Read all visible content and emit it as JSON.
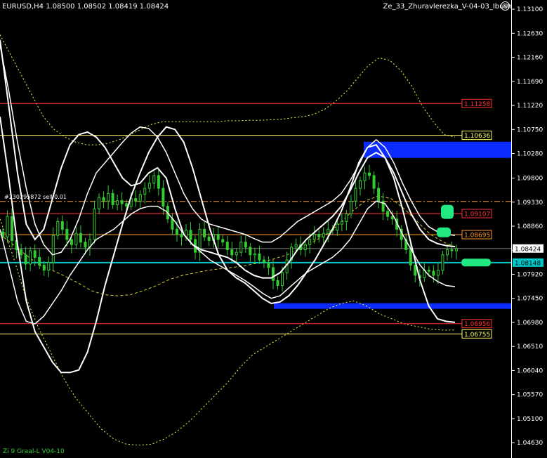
{
  "header": {
    "symbol_info": "EURUSD,H4  1.08500 1.08502 1.08419 1.08424",
    "indicator_name": "Ze_33_Zhuravlerezka_V-04-03_Ibush"
  },
  "footer": {
    "label": "Zi 9 Graal-L V04-10"
  },
  "order_label": "#230295872 sell 0.01",
  "colors": {
    "background": "#000000",
    "candles": "#33cc33",
    "bands": "#ffffff",
    "zone": "#0b2bff",
    "marker": "#22e882",
    "bid_line": "#00c8c8"
  },
  "chart_data": {
    "type": "candlestick",
    "symbol": "EURUSD",
    "timeframe": "H4",
    "ohlc": {
      "open": 1.085,
      "high": 1.08502,
      "low": 1.08419,
      "close": 1.08424
    },
    "ylim": [
      1.0433,
      1.1328
    ],
    "y_ticks": [
      "1.13100",
      "1.12630",
      "1.12160",
      "1.11690",
      "1.11220",
      "1.10750",
      "1.10280",
      "1.09800",
      "1.09330",
      "1.08860",
      "1.08390",
      "1.07920",
      "1.07450",
      "1.06980",
      "1.06510",
      "1.06040",
      "1.05570",
      "1.05100",
      "1.04630"
    ],
    "price_lines": [
      {
        "label": "1.11258",
        "value": 1.11258,
        "color": "#ff3333",
        "style": "solid"
      },
      {
        "label": "1.10636",
        "value": 1.10636,
        "color": "#ffff66",
        "style": "solid"
      },
      {
        "label": "1.09107",
        "value": 1.09107,
        "color": "#ff3333",
        "style": "solid"
      },
      {
        "label": "1.08695",
        "value": 1.08695,
        "color": "#ff9933",
        "style": "solid"
      },
      {
        "label": "1.06956",
        "value": 1.06956,
        "color": "#ff3333",
        "style": "solid"
      },
      {
        "label": "1.06755",
        "value": 1.06755,
        "color": "#ffff66",
        "style": "solid"
      }
    ],
    "order_line": {
      "value": 1.09344,
      "color": "#ff9933"
    },
    "current_price": {
      "label": "1.08424",
      "value": 1.08424
    },
    "bid_line": {
      "label": "1.08148",
      "value": 1.08148
    },
    "zones": [
      {
        "from": 1.10195,
        "to": 1.1051
      },
      {
        "from": 1.07245,
        "to": 1.07355
      }
    ],
    "markers": [
      {
        "index": 95,
        "value": 1.0914
      },
      {
        "index": 96,
        "value": 1.0874
      },
      {
        "index": 102,
        "value": 1.0815
      }
    ],
    "closes": [
      1.0865,
      1.0905,
      1.0858,
      1.084,
      1.083,
      1.0812,
      1.0838,
      1.0825,
      1.081,
      1.08,
      1.0815,
      1.0868,
      1.0895,
      1.088,
      1.086,
      1.085,
      1.0872,
      1.0855,
      1.0845,
      1.086,
      1.092,
      1.0942,
      1.0935,
      1.095,
      1.0928,
      1.0936,
      1.093,
      1.0925,
      1.094,
      1.0935,
      1.0948,
      1.096,
      1.097,
      1.0985,
      1.096,
      1.0925,
      1.09,
      1.088,
      1.087,
      1.0865,
      1.0878,
      1.086,
      1.0835,
      1.088,
      1.0865,
      1.0858,
      1.087,
      1.086,
      1.0855,
      1.084,
      1.083,
      1.0835,
      1.0855,
      1.0845,
      1.083,
      1.0832,
      1.082,
      1.0815,
      1.0805,
      1.078,
      1.077,
      1.0795,
      1.082,
      1.0845,
      1.085,
      1.084,
      1.085,
      1.086,
      1.087,
      1.0865,
      1.0872,
      1.088,
      1.0878,
      1.089,
      1.0895,
      1.091,
      1.0935,
      1.096,
      1.0975,
      1.099,
      1.0985,
      1.096,
      1.0935,
      1.0915,
      1.0905,
      1.09,
      1.088,
      1.086,
      1.084,
      1.081,
      1.079,
      1.0785,
      1.08,
      1.0798,
      1.079,
      1.08,
      1.083,
      1.084,
      1.0838,
      1.0842
    ],
    "bands": {
      "mid": [
        1.102,
        1.096,
        1.09,
        1.085,
        1.081,
        1.079,
        1.078,
        1.0785,
        1.08,
        1.083,
        1.087,
        1.09,
        1.0925,
        1.095,
        1.0975,
        1.0995,
        1.101,
        1.1015,
        1.101,
        1.099,
        1.096,
        1.0925,
        1.0895,
        1.087,
        1.0855,
        1.0845,
        1.0838,
        1.083,
        1.0818,
        1.0808,
        1.08,
        1.0802,
        1.0815,
        1.083,
        1.0843,
        1.0855,
        1.0865,
        1.0878,
        1.089,
        1.0905,
        1.092,
        1.0945,
        1.0975,
        1.0995,
        1.099,
        1.0965,
        1.0935,
        1.0905,
        1.0878,
        1.0858,
        1.0845,
        1.0838,
        1.0832
      ],
      "upper": [
        1.124,
        1.115,
        1.105,
        1.096,
        1.089,
        1.085,
        1.083,
        1.0835,
        1.086,
        1.09,
        1.095,
        1.099,
        1.101,
        1.103,
        1.105,
        1.1068,
        1.108,
        1.1077,
        1.106,
        1.103,
        1.099,
        1.095,
        1.092,
        1.09,
        1.089,
        1.0885,
        1.088,
        1.0875,
        1.087,
        1.0862,
        1.0855,
        1.0855,
        1.0865,
        1.088,
        1.0895,
        1.0905,
        1.0915,
        1.0925,
        1.0935,
        1.095,
        1.0975,
        1.1005,
        1.104,
        1.1055,
        1.104,
        1.101,
        1.097,
        1.0935,
        1.0905,
        1.0885,
        1.0875,
        1.087,
        1.0868
      ],
      "lower": [
        1.088,
        1.081,
        1.074,
        1.07,
        1.0695,
        1.071,
        1.0735,
        1.076,
        1.079,
        1.0815,
        1.084,
        1.086,
        1.087,
        1.088,
        1.0895,
        1.091,
        1.092,
        1.0925,
        1.0925,
        1.0915,
        1.0895,
        1.087,
        1.085,
        1.0835,
        1.082,
        1.081,
        1.08,
        1.079,
        1.078,
        1.0768,
        1.0755,
        1.0745,
        1.075,
        1.0765,
        1.078,
        1.0795,
        1.0805,
        1.0815,
        1.0825,
        1.084,
        1.086,
        1.089,
        1.092,
        1.0935,
        1.093,
        1.0905,
        1.087,
        1.084,
        1.081,
        1.079,
        1.0778,
        1.077,
        1.0768
      ],
      "outer_upper": [
        1.125,
        1.112,
        1.099,
        1.089,
        1.086,
        1.088,
        1.094,
        1.1,
        1.1045,
        1.1065,
        1.107,
        1.106,
        1.104,
        1.101,
        1.098,
        1.0965,
        1.097,
        1.099,
        1.1,
        1.098,
        1.092,
        1.087,
        1.085,
        1.084,
        1.0835,
        1.083,
        1.0825,
        1.0815,
        1.08,
        1.079,
        1.0785,
        1.0785,
        1.0795,
        1.0815,
        1.084,
        1.086,
        1.0875,
        1.089,
        1.0905,
        1.0925,
        1.0955,
        1.099,
        1.102,
        1.103,
        1.102,
        1.099,
        1.095,
        1.091,
        1.088,
        1.086,
        1.0852,
        1.0848,
        1.0846
      ],
      "outer_lower": [
        1.11,
        1.098,
        1.085,
        1.074,
        1.068,
        1.065,
        1.062,
        1.06,
        1.06,
        1.0605,
        1.064,
        1.07,
        1.077,
        1.083,
        1.089,
        1.0945,
        1.099,
        1.103,
        1.106,
        1.108,
        1.1075,
        1.105,
        1.1,
        1.094,
        1.088,
        1.083,
        1.08,
        1.0785,
        1.0775,
        1.076,
        1.0745,
        1.0735,
        1.0738,
        1.075,
        1.077,
        1.0795,
        1.082,
        1.085,
        1.088,
        1.0915,
        1.096,
        1.101,
        1.104,
        1.1045,
        1.102,
        1.098,
        1.092,
        1.085,
        1.078,
        1.073,
        1.0705,
        1.07,
        1.0698
      ]
    },
    "envelope": {
      "upper": [
        1.126,
        1.122,
        1.118,
        1.114,
        1.11,
        1.1075,
        1.106,
        1.105,
        1.1045,
        1.1045,
        1.1048,
        1.1055,
        1.1065,
        1.1075,
        1.1085,
        1.109,
        1.109,
        1.109,
        1.109,
        1.109,
        1.109,
        1.1092,
        1.1092,
        1.1093,
        1.1093,
        1.1094,
        1.1095,
        1.1098,
        1.11,
        1.1105,
        1.1115,
        1.113,
        1.115,
        1.1175,
        1.12,
        1.1215,
        1.121,
        1.119,
        1.116,
        1.112,
        1.109,
        1.1065,
        1.106
      ],
      "lower": [
        1.09,
        1.083,
        1.075,
        1.069,
        1.064,
        1.059,
        1.055,
        1.052,
        1.049,
        1.047,
        1.046,
        1.0458,
        1.046,
        1.047,
        1.0485,
        1.0505,
        1.053,
        1.0555,
        1.058,
        1.061,
        1.0635,
        1.065,
        1.0665,
        1.068,
        1.0695,
        1.071,
        1.0725,
        1.0735,
        1.074,
        1.073,
        1.0715,
        1.0705,
        1.0695,
        1.069,
        1.0685,
        1.0683,
        1.0683
      ]
    },
    "ma": [
      1.087,
      1.085,
      1.083,
      1.081,
      1.08,
      1.0788,
      1.0775,
      1.076,
      1.0752,
      1.075,
      1.0752,
      1.076,
      1.077,
      1.0782,
      1.079,
      1.0795,
      1.08,
      1.0803,
      1.0806,
      1.081,
      1.0815,
      1.0822,
      1.083,
      1.0842,
      1.0855,
      1.087,
      1.089,
      1.0915,
      1.0935,
      1.0945,
      1.094,
      1.092,
      1.0895,
      1.087,
      1.0855,
      1.0845
    ]
  }
}
